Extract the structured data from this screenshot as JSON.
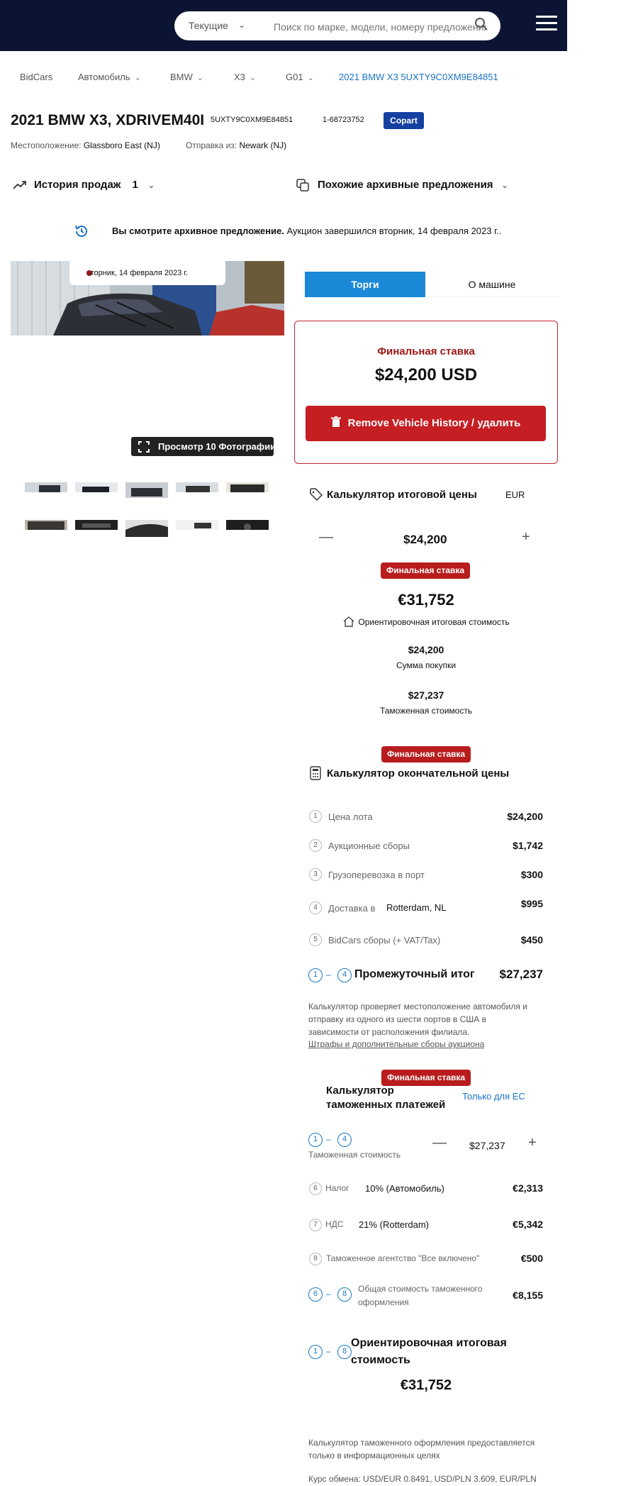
{
  "header": {
    "filter_select": "Текущие",
    "search_placeholder": "Поиск по марке, модели, номеру предложения"
  },
  "breadcrumb": {
    "items": [
      "BidCars",
      "Автомобиль",
      "BMW",
      "X3",
      "G01"
    ],
    "current": "2021 BMW X3 5UXTY9C0XM9E84851"
  },
  "vehicle": {
    "title": "2021 BMW X3, XDRIVEM40I",
    "vin": "5UXTY9C0XM9E84851",
    "lot": "1-68723752",
    "auction": "Copart",
    "location_label": "Местоположение:",
    "location": "Glassboro East (NJ)",
    "ship_label": "Отправка из:",
    "ship_from": "Newark (NJ)"
  },
  "history": {
    "label": "История продаж",
    "count": "1"
  },
  "similar": {
    "label": "Похожие архивные предложения"
  },
  "notice": {
    "bold": "Вы смотрите архивное предложение.",
    "text": " Аукцион завершился вторник, 14 февраля 2023 г.."
  },
  "gallery": {
    "date": "вторник, 14 февраля 2023 г.",
    "view_button": "Просмотр 10 Фотографии"
  },
  "tabs": [
    "Торги",
    "О машине"
  ],
  "final_bid": {
    "label": "Финальная ставка",
    "amount": "$24,200 USD",
    "remove_button": "Remove Vehicle History / удалить"
  },
  "calc": {
    "title": "Калькулятор итоговой цены",
    "currency": "EUR",
    "bid_value": "$24,200",
    "badge": "Финальная ставка",
    "total": "€31,752",
    "total_label": "Ориентировочная итоговая стоимость",
    "purchase_value": "$24,200",
    "purchase_label": "Сумма покупки",
    "customs_value": "$27,237",
    "customs_label": "Таможенная стоимость"
  },
  "final_calc": {
    "badge": "Финальная ставка",
    "title": "Калькулятор окончательной цены",
    "rows": [
      {
        "idx": "1",
        "label": "Цена лота",
        "value": "$24,200"
      },
      {
        "idx": "2",
        "label": "Аукционные сборы",
        "value": "$1,742"
      },
      {
        "idx": "3",
        "label": "Грузоперевозка в порт",
        "value": "$300"
      },
      {
        "idx": "4",
        "label": "Доставка в",
        "value": "$995"
      },
      {
        "idx": "5",
        "label": "BidCars сборы (+ VAT/Tax)",
        "value": "$450"
      }
    ],
    "port": "Rotterdam, NL",
    "subtotal_from": "1",
    "subtotal_to": "4",
    "subtotal_label": "Промежуточный итог",
    "subtotal_value": "$27,237",
    "note": "Калькулятор проверяет местоположение автомобиля и отправку из одного из шести портов в США в зависимости от расположения филиала.",
    "link": "Штрафы и дополнительные сборы аукциона"
  },
  "customs": {
    "badge": "Финальная ставка",
    "title": "Калькулятор таможенных платежей",
    "eu_only": "Только для ЕС",
    "from": "1",
    "to": "4",
    "value_label": "Таможенная стоимость",
    "value": "$27,237",
    "rows": [
      {
        "idx": "6",
        "label": "Налог",
        "extra": "10% (Автомобиль)",
        "value": "€2,313"
      },
      {
        "idx": "7",
        "label": "НДС",
        "extra": "21% (Rotterdam)",
        "value": "€5,342"
      },
      {
        "idx": "8",
        "label": "Таможенное агентство \"Все включено\"",
        "extra": "",
        "value": "€500"
      }
    ],
    "total_from": "6",
    "total_to": "8",
    "total_label": "Общая стоимость таможенного оформления",
    "total_value": "€8,155",
    "final_from": "1",
    "final_to": "8",
    "final_label": "Ориентировочная итоговая стоимость",
    "final_value": "€31,752",
    "disclaimer": "Калькулятор таможенного оформления предоставляется только в информационных целях",
    "rates": "Курс обмена: USD/EUR 0.8491, USD/PLN 3.609, EUR/PLN"
  }
}
